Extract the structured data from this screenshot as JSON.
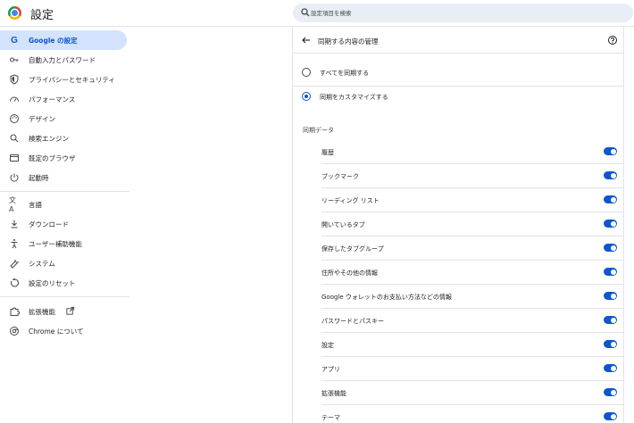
{
  "header": {
    "title": "設定",
    "search_placeholder": "設定項目を検索"
  },
  "sidebar": {
    "items": [
      {
        "label": "Google の設定",
        "icon": "google-icon",
        "active": true
      },
      {
        "label": "自動入力とパスワード",
        "icon": "key-icon"
      },
      {
        "label": "プライバシーとセキュリティ",
        "icon": "shield-icon"
      },
      {
        "label": "パフォーマンス",
        "icon": "speedometer-icon"
      },
      {
        "label": "デザイン",
        "icon": "palette-icon"
      },
      {
        "label": "検索エンジン",
        "icon": "search-icon"
      },
      {
        "label": "既定のブラウザ",
        "icon": "browser-icon"
      },
      {
        "label": "起動時",
        "icon": "power-icon"
      },
      {
        "label": "言語",
        "icon": "translate-icon"
      },
      {
        "label": "ダウンロード",
        "icon": "download-icon"
      },
      {
        "label": "ユーザー補助機能",
        "icon": "accessibility-icon"
      },
      {
        "label": "システム",
        "icon": "wrench-icon"
      },
      {
        "label": "設定のリセット",
        "icon": "reset-icon"
      },
      {
        "label": "拡張機能",
        "icon": "puzzle-icon"
      },
      {
        "label": "Chrome について",
        "icon": "chrome-icon"
      }
    ]
  },
  "card": {
    "title": "同期する内容の管理",
    "radio_options": [
      {
        "label": "すべてを同期する",
        "checked": false
      },
      {
        "label": "同期をカスタマイズする",
        "checked": true
      }
    ],
    "section_title": "同期データ",
    "sync_items": [
      {
        "label": "履歴",
        "on": true
      },
      {
        "label": "ブックマーク",
        "on": true
      },
      {
        "label": "リーディング リスト",
        "on": true
      },
      {
        "label": "開いているタブ",
        "on": true
      },
      {
        "label": "保存したタブグループ",
        "on": true
      },
      {
        "label": "住所やその他の情報",
        "on": true
      },
      {
        "label": "Google ウォレットのお支払い方法などの情報",
        "on": true
      },
      {
        "label": "パスワードとパスキー",
        "on": true
      },
      {
        "label": "設定",
        "on": true
      },
      {
        "label": "アプリ",
        "on": true
      },
      {
        "label": "拡張機能",
        "on": true
      },
      {
        "label": "テーマ",
        "on": true
      }
    ]
  },
  "colors": {
    "accent": "#0b57d0",
    "active_nav_bg": "#d3e3fd",
    "search_bg": "#e9eef6"
  }
}
